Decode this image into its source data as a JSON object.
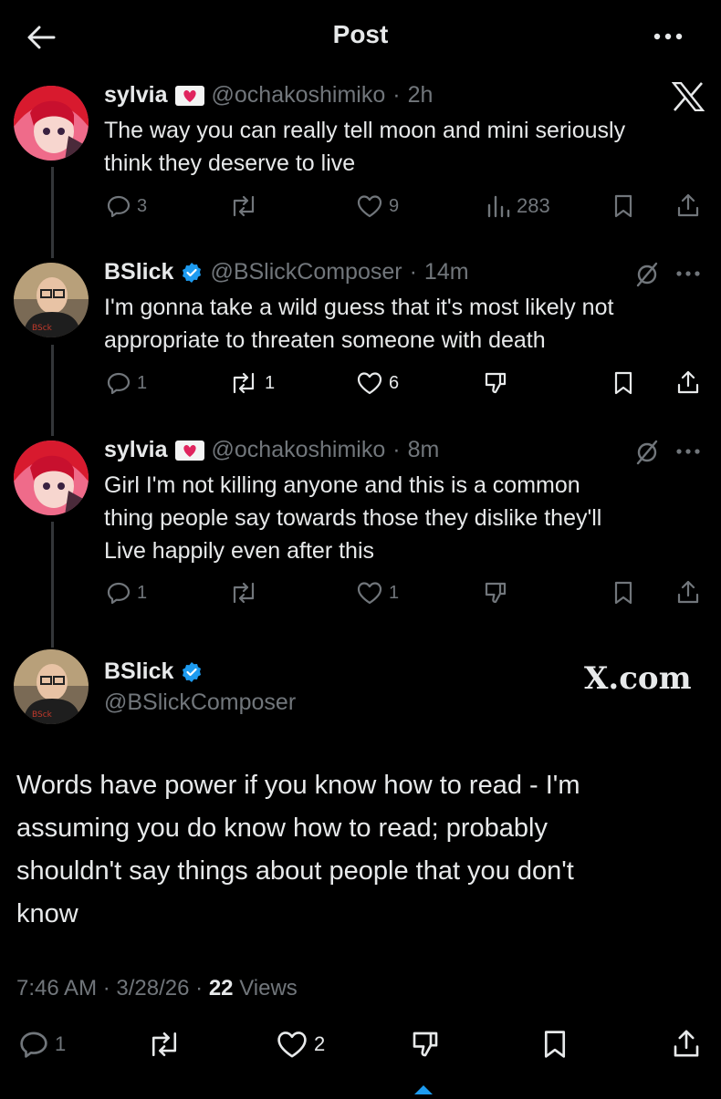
{
  "header": {
    "title": "Post",
    "back_icon": "arrow-left-icon",
    "more_icon": "more-horizontal-icon"
  },
  "colors": {
    "background": "#000000",
    "text": "#e7e9ea",
    "muted": "#71767b",
    "verified": "#1d9bf0",
    "thread_line": "#333639"
  },
  "tweets": [
    {
      "name": "sylvia",
      "badge": "heart-envelope-emoji",
      "handle": "@ochakoshimiko",
      "sep": "·",
      "time": "2h",
      "corner_label": "X",
      "text_lines": [
        "The way you can really tell moon and mini seriously",
        "think they deserve to live"
      ],
      "replies": "3",
      "reposts": "",
      "likes": "9",
      "views": "283"
    },
    {
      "name": "BSlick",
      "handle": "@BSlickComposer",
      "sep": "·",
      "time": "14m",
      "text_lines": [
        "I'm gonna take a wild guess that it's most likely not",
        "appropriate to threaten someone with death"
      ],
      "replies": "1",
      "reposts": "1",
      "likes": "6"
    },
    {
      "name": "sylvia",
      "badge": "heart-envelope-emoji",
      "handle": "@ochakoshimiko",
      "sep": "·",
      "time": "8m",
      "text_lines": [
        "Girl I'm not killing anyone and this is a common",
        "thing people say towards those they dislike they'll",
        "Live happily even after this"
      ],
      "replies": "1",
      "reposts": "",
      "likes": "1"
    }
  ],
  "main_post": {
    "name": "BSlick",
    "handle": "@BSlickComposer",
    "watermark": "X.com",
    "text_lines": [
      "Words have power if you know how to read - I'm",
      "assuming you do know how to read; probably",
      "shouldn't say things about people that you don't",
      "know"
    ],
    "time": "7:46 AM",
    "date": "3/28/26",
    "views_count": "22",
    "views_label": "Views",
    "replies": "1",
    "reposts": "",
    "likes": "2"
  }
}
